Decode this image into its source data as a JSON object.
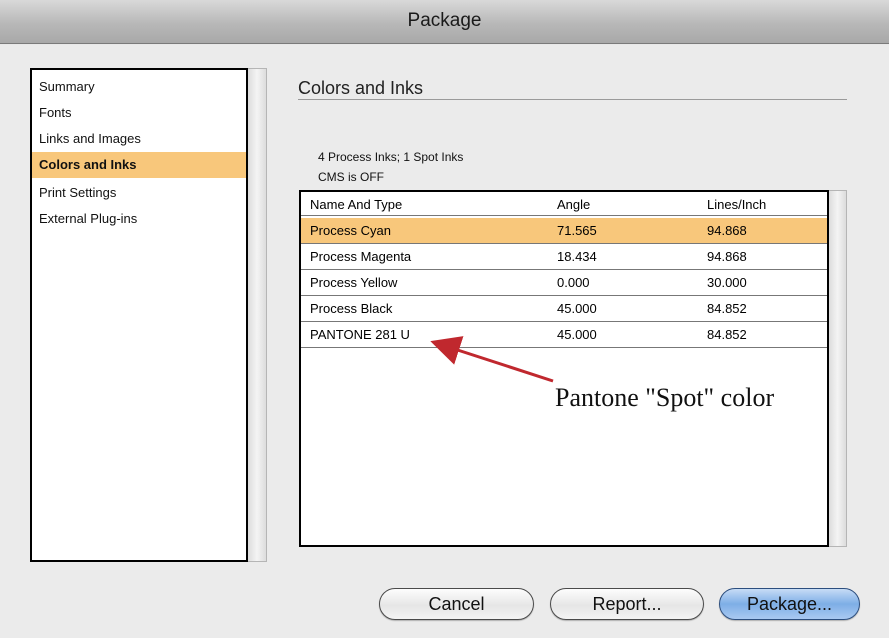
{
  "window": {
    "title": "Package"
  },
  "sidebar": {
    "items": [
      {
        "label": "Summary",
        "selected": false
      },
      {
        "label": "Fonts",
        "selected": false
      },
      {
        "label": "Links and Images",
        "selected": false
      },
      {
        "label": "Colors and Inks",
        "selected": true
      },
      {
        "label": "Print Settings",
        "selected": false
      },
      {
        "label": "External Plug-ins",
        "selected": false
      }
    ]
  },
  "main": {
    "title": "Colors and Inks",
    "summary": [
      "4 Process Inks; 1 Spot Inks",
      "CMS is OFF"
    ],
    "table": {
      "columns": [
        "Name And Type",
        "Angle",
        "Lines/Inch"
      ],
      "rows": [
        {
          "cells": [
            "Process Cyan",
            "71.565",
            "94.868"
          ],
          "selected": true
        },
        {
          "cells": [
            "Process Magenta",
            "18.434",
            "94.868"
          ],
          "selected": false
        },
        {
          "cells": [
            "Process Yellow",
            "0.000",
            "30.000"
          ],
          "selected": false
        },
        {
          "cells": [
            "Process Black",
            "45.000",
            "84.852"
          ],
          "selected": false
        },
        {
          "cells": [
            "PANTONE 281 U",
            "45.000",
            "84.852"
          ],
          "selected": false
        }
      ]
    }
  },
  "annotation": {
    "text": "Pantone \"Spot\" color",
    "color": "#c0282e"
  },
  "buttons": {
    "cancel": "Cancel",
    "report": "Report...",
    "package": "Package..."
  },
  "colors": {
    "selection": "#f8c77b",
    "primary_button": "#7eaee6"
  }
}
